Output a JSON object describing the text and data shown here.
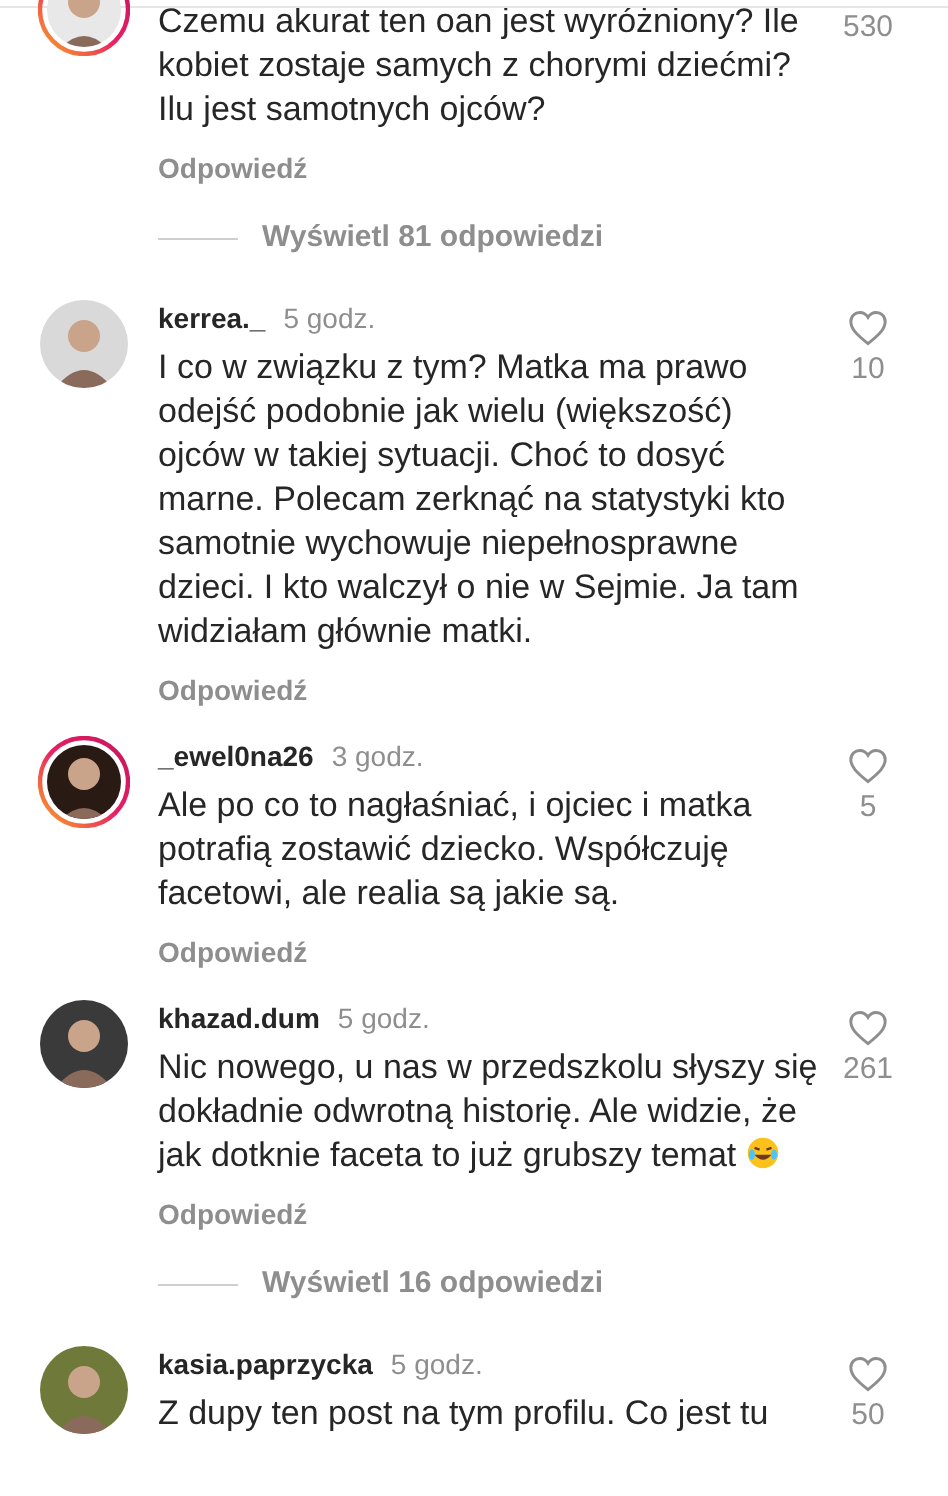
{
  "items": [
    {
      "kind": "comment",
      "clipped_top": true,
      "story_ring": true,
      "text": "Czemu akurat ten oan jest wyróżniony? Ile kobiet zostaje samych z chorymi dziećmi? Ilu jest samotnych ojców?",
      "likes": "530",
      "reply": "Odpowiedź"
    },
    {
      "kind": "replies",
      "label": "Wyświetl 81 odpowiedzi"
    },
    {
      "kind": "comment",
      "clipped_top": false,
      "story_ring": false,
      "username": "kerrea._",
      "time": "5 godz.",
      "text": "I co w związku z tym? Matka ma prawo odejść podobnie jak wielu (większość) ojców w takiej sytuacji. Choć to dosyć marne. Polecam zerknąć na statystyki kto samotnie wychowuje niepełnosprawne dzieci. I kto walczył o nie w Sejmie. Ja tam widziałam głównie matki.",
      "likes": "10",
      "reply": "Odpowiedź"
    },
    {
      "kind": "comment",
      "clipped_top": false,
      "story_ring": true,
      "username": "_ewel0na26",
      "time": "3 godz.",
      "text": "Ale po co to nagłaśniać, i ojciec i matka potrafią zostawić dziecko. Współczuję facetowi, ale realia są jakie są.",
      "likes": "5",
      "reply": "Odpowiedź"
    },
    {
      "kind": "comment",
      "clipped_top": false,
      "story_ring": false,
      "username": "khazad.dum",
      "time": "5 godz.",
      "text": "Nic nowego, u nas w przedszkolu słyszy się dokładnie odwrotną historię. Ale widzie, że jak dotknie faceta to już grubszy temat",
      "emoji": true,
      "likes": "261",
      "reply": "Odpowiedź"
    },
    {
      "kind": "replies",
      "label": "Wyświetl 16 odpowiedzi"
    },
    {
      "kind": "comment",
      "clipped_top": false,
      "story_ring": false,
      "username": "kasia.paprzycka",
      "time": "5 godz.",
      "text": "Z dupy ten post na tym profilu. Co jest tu",
      "likes": "50"
    }
  ]
}
